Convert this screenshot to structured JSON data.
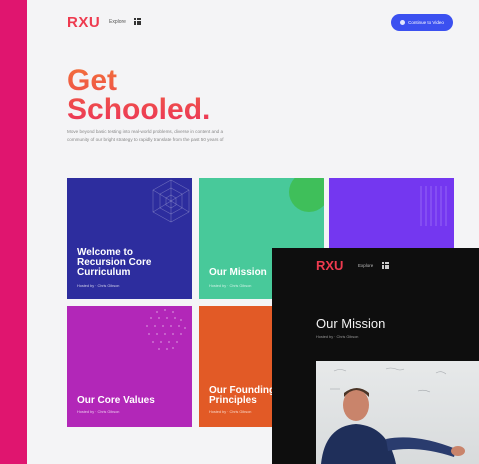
{
  "nav": {
    "logo": "RXU",
    "explore_label": "Explore",
    "cta_label": "Continue to Video"
  },
  "hero": {
    "title_line1": "Get",
    "title_line2": "Schooled.",
    "description": "Move beyond basic testing into real-world problems, diverse in content and a community of our bright strategy to rapidly translate from the past 50 years of"
  },
  "cards": [
    {
      "title": "Welcome to Recursion Core Curriculum",
      "subtitle": "Hosted by · Chris Gibson"
    },
    {
      "title": "Our Mission",
      "subtitle": "Hosted by · Chris Gibson"
    },
    {
      "title": "",
      "subtitle": ""
    },
    {
      "title": "Our Core Values",
      "subtitle": "Hosted by · Chris Gibson"
    },
    {
      "title": "Our Founding Principles",
      "subtitle": "Hosted by · Chris Gibson"
    }
  ],
  "video_window": {
    "logo": "RXU",
    "explore_label": "Explore",
    "title": "Our Mission",
    "subtitle": "Hosted by · Chris Gibson"
  },
  "colors": {
    "background": "#e0156f",
    "logo": "#ee3a4f",
    "cta": "#3b50f0",
    "card_1": "#2d2d9e",
    "card_2": "#48c99a",
    "card_3": "#7437f0",
    "card_4": "#b227b8",
    "card_5": "#e25a26"
  }
}
